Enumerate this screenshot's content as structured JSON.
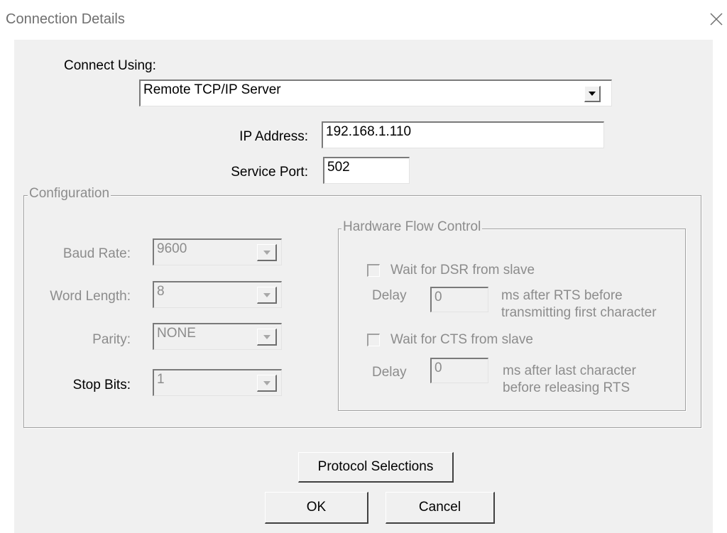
{
  "window": {
    "title": "Connection Details"
  },
  "connect_using": {
    "label": "Connect Using:",
    "value": "Remote TCP/IP Server"
  },
  "ip_address": {
    "label": "IP Address:",
    "value": "192.168.1.110"
  },
  "service_port": {
    "label": "Service Port:",
    "value": "502"
  },
  "configuration": {
    "legend": "Configuration",
    "baud_rate": {
      "label": "Baud Rate:",
      "value": "9600"
    },
    "word_length": {
      "label": "Word Length:",
      "value": "8"
    },
    "parity": {
      "label": "Parity:",
      "value": "NONE"
    },
    "stop_bits": {
      "label": "Stop Bits:",
      "value": "1"
    }
  },
  "hardware_flow": {
    "legend": "Hardware Flow Control",
    "dsr": {
      "label": "Wait for DSR from slave",
      "delay_label": "Delay",
      "delay_value": "0",
      "note_line1": "ms after RTS before",
      "note_line2": "transmitting first character"
    },
    "cts": {
      "label": "Wait for CTS from slave",
      "delay_label": "Delay",
      "delay_value": "0",
      "note_line1": "ms after last character",
      "note_line2": "before releasing RTS"
    }
  },
  "buttons": {
    "protocol": "Protocol Selections",
    "ok": "OK",
    "cancel": "Cancel"
  }
}
